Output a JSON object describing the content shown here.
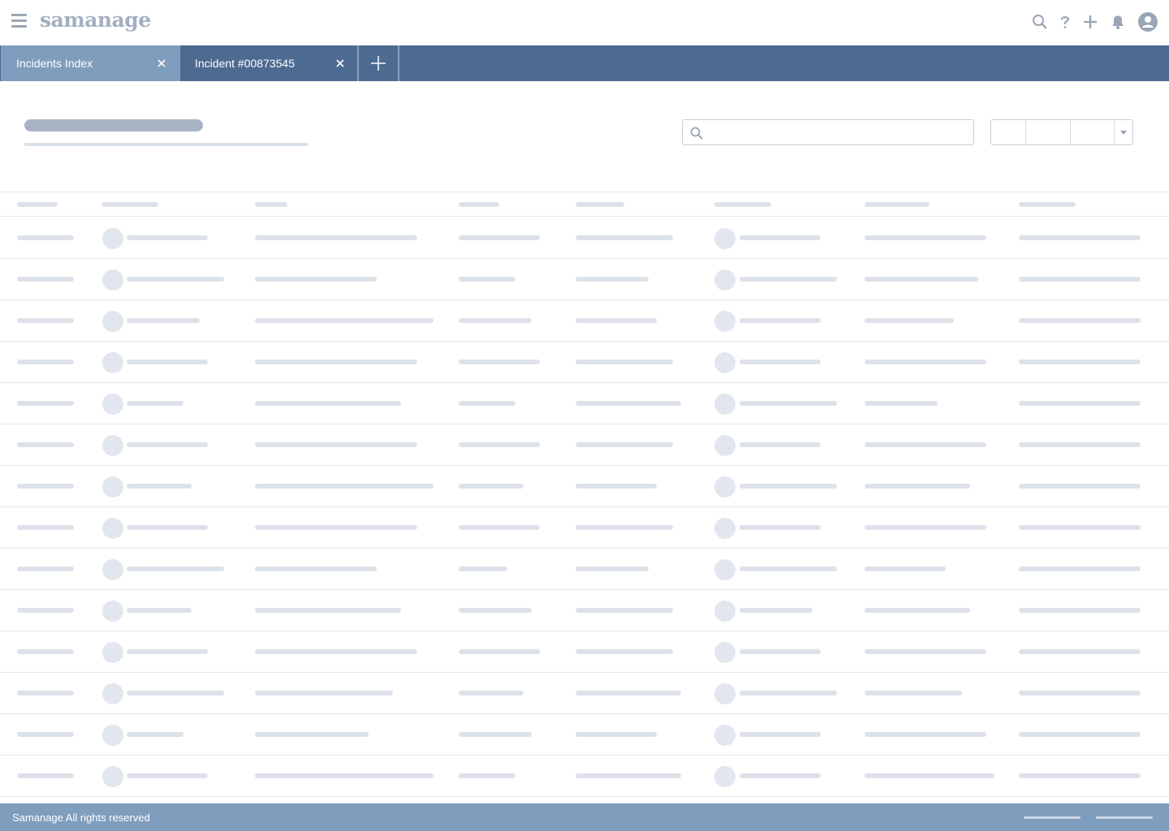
{
  "app": {
    "logo_text": "samanage"
  },
  "topbar": {
    "icons": [
      "search-icon",
      "help-icon",
      "plus-icon",
      "bell-icon",
      "user-avatar-icon"
    ]
  },
  "tabs": [
    {
      "label": "Incidents Index",
      "active": true
    },
    {
      "label": "Incident #00873545",
      "active": false
    }
  ],
  "search": {
    "value": "",
    "placeholder": ""
  },
  "footer": {
    "text": "Samanage All rights reserved"
  },
  "colors": {
    "topbar_bg": "#ffffff",
    "tabbar_bg": "#4d6a91",
    "active_tab_bg": "#7f9dbd",
    "footer_bg": "#7f9dbd",
    "skeleton": "#dde2ea",
    "logo": "#a3afc0"
  }
}
